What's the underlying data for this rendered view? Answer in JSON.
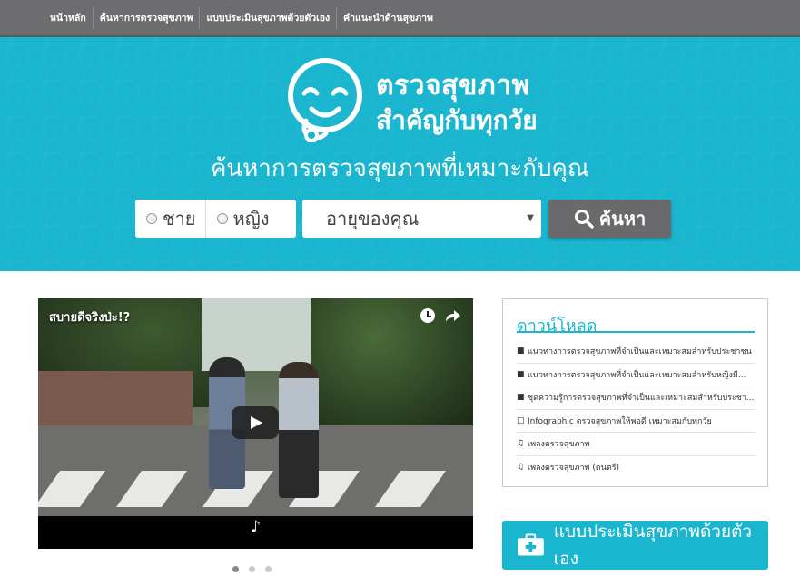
{
  "nav": {
    "items": [
      {
        "label": "หน้าหลัก"
      },
      {
        "label": "ค้นหาการตรวจสุขภาพ"
      },
      {
        "label": "แบบประเมินสุขภาพด้วยตัวเอง"
      },
      {
        "label": "คำแนะนำด้านสุขภาพ"
      }
    ]
  },
  "hero": {
    "logo_line1": "ตรวจสุขภาพ",
    "logo_line2": "สำคัญกับทุกวัย",
    "title": "ค้นหาการตรวจสุขภาพที่เหมาะกับคุณ",
    "gender_male": "ชาย",
    "gender_female": "หญิง",
    "age_select": "อายุของคุณ",
    "search_label": "ค้นหา"
  },
  "video": {
    "title": "สบายดีจริงป่ะ!?",
    "note": "♪",
    "slide_count": 3,
    "active_slide": 1
  },
  "downloads": {
    "title": "ดาวน์โหลด",
    "items": [
      {
        "icon": "book-icon",
        "label": "แนวทางการตรวจสุขภาพที่จำเป็นและเหมาะสมสำหรับประชาชน"
      },
      {
        "icon": "book-icon",
        "label": "แนวทางการตรวจสุขภาพที่จำเป็นและเหมาะสมสำหรับหญิงมี..."
      },
      {
        "icon": "book-icon",
        "label": "ชุดความรู้การตรวจสุขภาพที่จำเป็นและเหมาะสมสำหรับประชา..."
      },
      {
        "icon": "file-icon",
        "label": "Infographic ตรวจสุขภาพให้พอดี เหมาะสมกับทุกวัย"
      },
      {
        "icon": "music-icon",
        "label": "เพลงตรวจสุขภาพ"
      },
      {
        "icon": "music-icon",
        "label": "เพลงตรวจสุขภาพ (ดนตรี)"
      }
    ]
  },
  "assess": {
    "label": "แบบประเมินสุขภาพด้วยตัวเอง"
  },
  "colors": {
    "brand": "#1ab5ce",
    "nav": "#6d6d70",
    "button_gray": "#6a6a6d"
  }
}
